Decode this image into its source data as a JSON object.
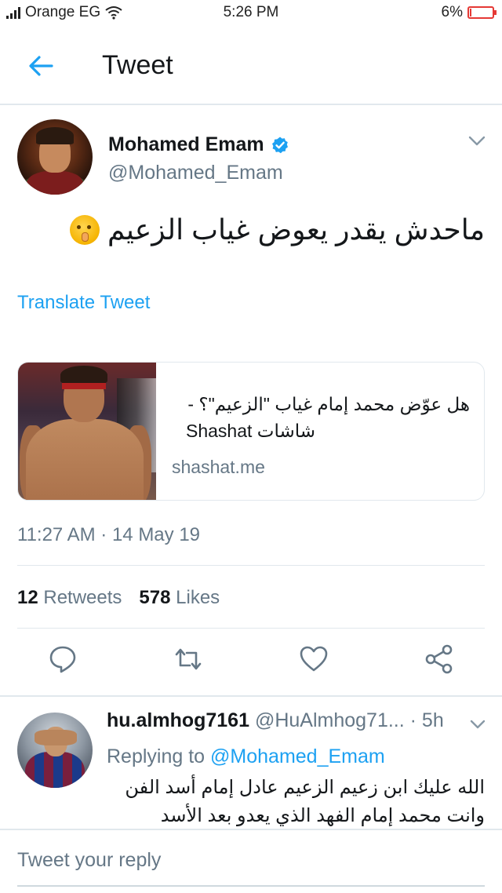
{
  "status_bar": {
    "carrier": "Orange EG",
    "time": "5:26 PM",
    "battery": "6%",
    "battery_level": 0.06
  },
  "header": {
    "title": "Tweet",
    "back_icon": "arrow-left-icon"
  },
  "tweet": {
    "author_name": "Mohamed Emam",
    "author_handle": "@Mohamed_Emam",
    "verified": true,
    "text": "ماحدش يقدر يعوض غياب الزعيم",
    "emoji": "shushing-face",
    "translate_label": "Translate Tweet",
    "card": {
      "title_line1": "هل عوّض محمد إمام غياب \"الزعيم\"؟ -",
      "title_line2": "شاشات Shashat",
      "domain": "shashat.me"
    },
    "timestamp": "11:27 AM · 14 May 19",
    "retweets_count": "12",
    "retweets_label": "Retweets",
    "likes_count": "578",
    "likes_label": "Likes"
  },
  "actions": [
    "reply-icon",
    "retweet-icon",
    "like-icon",
    "share-icon"
  ],
  "reply": {
    "name": "hu.almhog7161",
    "handle": "@HuAlmhog71...",
    "time": "· 5h",
    "replying_prefix": "Replying to",
    "replying_to": "@Mohamed_Emam",
    "text_line1": "الله عليك ابن زعيم الزعيم عادل إمام أسد الفن",
    "text_line2": "وانت محمد إمام الفهد الذي يعدو بعد الأسد تحياتي"
  },
  "composer": {
    "placeholder": "Tweet your reply"
  },
  "colors": {
    "accent": "#1da1f2",
    "secondary_text": "#657786",
    "divider": "#e1e8ed",
    "battery_low": "#e53935"
  }
}
